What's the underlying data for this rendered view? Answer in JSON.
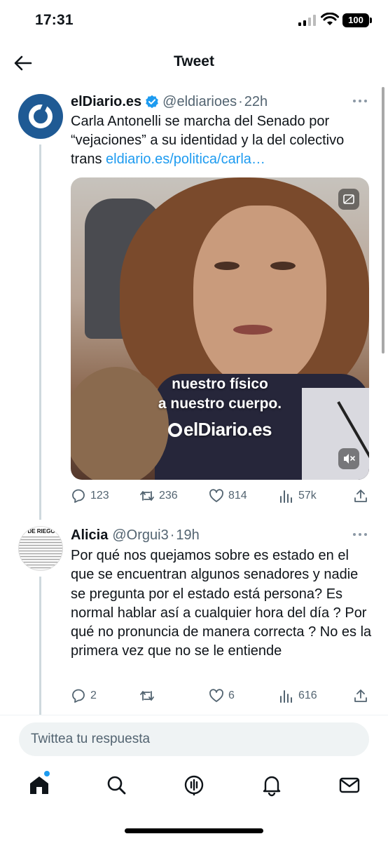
{
  "status_bar": {
    "time": "17:31",
    "battery": "100"
  },
  "header": {
    "title": "Tweet"
  },
  "tweet": {
    "author_name": "elDiario.es",
    "author_handle": "@eldiarioes",
    "separator": "·",
    "timestamp": "22h",
    "text": "Carla Antonelli se marcha del Senado por “vejaciones” a su identidad y la del colectivo trans ",
    "link_text": "eldiario.es/politica/carla…",
    "media": {
      "caption_line1": "nuestro físico",
      "caption_line2": "a nuestro cuerpo.",
      "logo_text": "elDiario.es"
    },
    "stats": {
      "replies": "123",
      "retweets": "236",
      "likes": "814",
      "views": "57k"
    }
  },
  "reply": {
    "author_name": "Alicia",
    "author_handle": "@Orgui3",
    "separator": "·",
    "timestamp": "19h",
    "avatar_text": "DE RIEGO",
    "text": "Por qué nos quejamos sobre es estado en el que se encuentran algunos senadores y nadie se pregunta por el estado está persona? Es normal hablar así a cualquier hora del día ? Por qué no pronuncia de manera correcta ? No es la primera vez que no se le entiende",
    "stats": {
      "replies": "2",
      "retweets": "",
      "likes": "6",
      "views": "616"
    }
  },
  "composer": {
    "placeholder": "Twittea tu respuesta"
  },
  "tabs": [
    "home-icon",
    "search-icon",
    "spaces-icon",
    "notifications-icon",
    "messages-icon"
  ],
  "colors": {
    "link": "#1d9bf0",
    "muted": "#536471",
    "avatar_blue": "#1f5a94"
  }
}
